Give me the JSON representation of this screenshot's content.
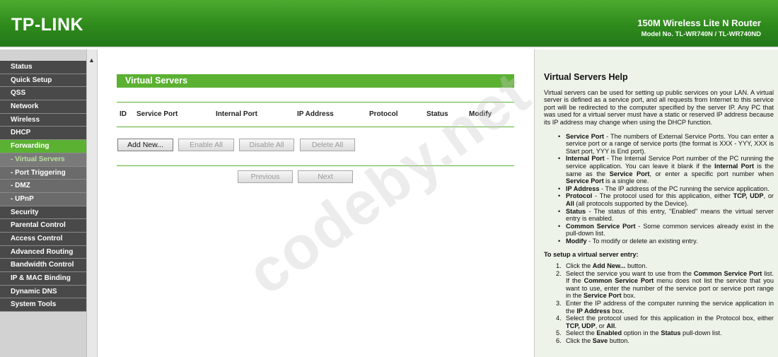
{
  "header": {
    "logo": "TP-LINK",
    "product_title": "150M Wireless Lite N Router",
    "model": "Model No. TL-WR740N / TL-WR740ND",
    "brand_color": "#3c9a27"
  },
  "sidebar": {
    "items": [
      {
        "label": "Status"
      },
      {
        "label": "Quick Setup"
      },
      {
        "label": "QSS"
      },
      {
        "label": "Network"
      },
      {
        "label": "Wireless"
      },
      {
        "label": "DHCP"
      },
      {
        "label": "Forwarding"
      },
      {
        "label": "- Virtual Servers"
      },
      {
        "label": "- Port Triggering"
      },
      {
        "label": "- DMZ"
      },
      {
        "label": "- UPnP"
      },
      {
        "label": "Security"
      },
      {
        "label": "Parental Control"
      },
      {
        "label": "Access Control"
      },
      {
        "label": "Advanced Routing"
      },
      {
        "label": "Bandwidth Control"
      },
      {
        "label": "IP & MAC Binding"
      },
      {
        "label": "Dynamic DNS"
      },
      {
        "label": "System Tools"
      }
    ]
  },
  "main": {
    "title": "Virtual Servers",
    "columns": [
      "ID",
      "Service Port",
      "Internal Port",
      "IP Address",
      "Protocol",
      "Status",
      "Modify"
    ],
    "buttons": {
      "add_new": "Add New...",
      "enable_all": "Enable All",
      "disable_all": "Disable All",
      "delete_all": "Delete All",
      "previous": "Previous",
      "next": "Next"
    }
  },
  "help": {
    "title": "Virtual Servers Help",
    "intro": "Virtual servers can be used for setting up public services on your LAN. A virtual server is defined as a service port, and all requests from Internet to this service port will be redirected to the computer specified by the server IP. Any PC that was used for a virtual server must have a static or reserved IP address because its IP address may change when using the DHCP function.",
    "bullets": [
      {
        "term": "Service Port",
        "text": " - The numbers of External Service Ports. You can enter a service port or a range of service ports (the format is XXX - YYY, XXX is Start port, YYY is End port)."
      },
      {
        "term": "Internal Port",
        "text": " - The Internal Service Port number of the PC running the service application. You can leave it blank if the ",
        "term2": "Internal Port",
        "text2": " is the same as the ",
        "term3": "Service Port",
        "text3": ", or enter a specific port number when ",
        "term4": "Service Port",
        "text4": " is a single one."
      },
      {
        "term": "IP Address",
        "text": " - The IP address of the PC running the service application."
      },
      {
        "term": "Protocol",
        "text": " - The protocol used for this application, either ",
        "term2": "TCP, UDP",
        "text2": ", or ",
        "term3": "All",
        "text3": " (all protocols supported by the Device)."
      },
      {
        "term": "Status",
        "text": " - The status of this entry, \"Enabled\" means the virtual server entry is enabled."
      },
      {
        "term": "Common Service Port",
        "text": " - Some common services already exist in the pull-down list."
      },
      {
        "term": "Modify",
        "text": " - To modify or delete an existing entry."
      }
    ],
    "setup_heading": "To setup a virtual server entry:",
    "steps": [
      {
        "n": "1.",
        "a": "Click the ",
        "b": "Add New...",
        "c": " button."
      },
      {
        "n": "2.",
        "a": "Select the service you want to use from the ",
        "b": "Common Service Port",
        "c": " list. If the ",
        "b2": "Common Service Port",
        "c2": " menu does not list the service that you want to use, enter the number of the service port or service port range in the ",
        "b3": "Service Port",
        "c3": " box."
      },
      {
        "n": "3.",
        "a": "Enter the IP address of the computer running the service application in the ",
        "b": "IP Address",
        "c": " box."
      },
      {
        "n": "4.",
        "a": "Select the protocol used for this application in the Protocol box, either ",
        "b": "TCP, UDP",
        "c": ", or ",
        "b2": "All",
        "c2": "."
      },
      {
        "n": "5.",
        "a": "Select the ",
        "b": "Enabled",
        "c": " option in the ",
        "b2": "Status",
        "c2": " pull-down list."
      },
      {
        "n": "6.",
        "a": "Click the ",
        "b": "Save",
        "c": " button."
      }
    ]
  },
  "watermark": "codeby.net"
}
